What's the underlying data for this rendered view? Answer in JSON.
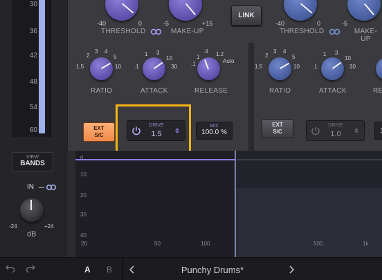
{
  "meter": {
    "ticks": [
      "30",
      "36",
      "42",
      "48",
      "54",
      "60"
    ]
  },
  "left_controls": {
    "view_label": "VIEW",
    "bands_label": "BANDS",
    "in_label": "IN",
    "in_min": "-24",
    "in_max": "+24",
    "unit": "dB"
  },
  "band1": {
    "threshold_min": "-40",
    "threshold_max": "0",
    "threshold_label": "THRESHOLD",
    "makeup_label": "MAKE-UP",
    "makeup_min": "-5",
    "makeup_max": "+15",
    "ratio_label": "RATIO",
    "ratio_scale": [
      "1.5",
      "2",
      "3",
      "4",
      "5",
      "10"
    ],
    "attack_label": "ATTACK",
    "attack_scale": [
      ".1",
      "1",
      "3",
      "10",
      "30"
    ],
    "release_label": "RELEASE",
    "release_scale": [
      ".1",
      ".4",
      "1",
      "1.2",
      "Auto"
    ],
    "ext_sc_line1": "EXT",
    "ext_sc_line2": "S/C",
    "drive_label": "DRIVE",
    "drive_value": "1.5",
    "mix_label": "MIX",
    "mix_value": "100.0 %"
  },
  "link_label": "LINK",
  "band2": {
    "threshold_min": "-40",
    "threshold_max": "0",
    "threshold_label": "THRESHOLD",
    "makeup_label": "MAKE-UP",
    "makeup_min": "-5",
    "ratio_label": "RATIO",
    "ratio_scale": [
      "1.5",
      "2",
      "3",
      "4",
      "5",
      "10"
    ],
    "attack_label": "ATTACK",
    "attack_scale": [
      ".1",
      "1",
      "3",
      "10",
      "30"
    ],
    "release_label": "RE",
    "ext_sc_line1": "EXT",
    "ext_sc_line2": "S/C",
    "drive_label": "DRIVE",
    "drive_value": "1.0",
    "mix_value": "1"
  },
  "graph": {
    "y_labels": [
      "0",
      "10",
      "20",
      "30",
      "40"
    ],
    "x_labels": [
      "20",
      "50",
      "100",
      "500",
      "1k"
    ]
  },
  "bottom_bar": {
    "preset_name": "Punchy Drums*",
    "a_label": "A",
    "b_label": "B"
  }
}
